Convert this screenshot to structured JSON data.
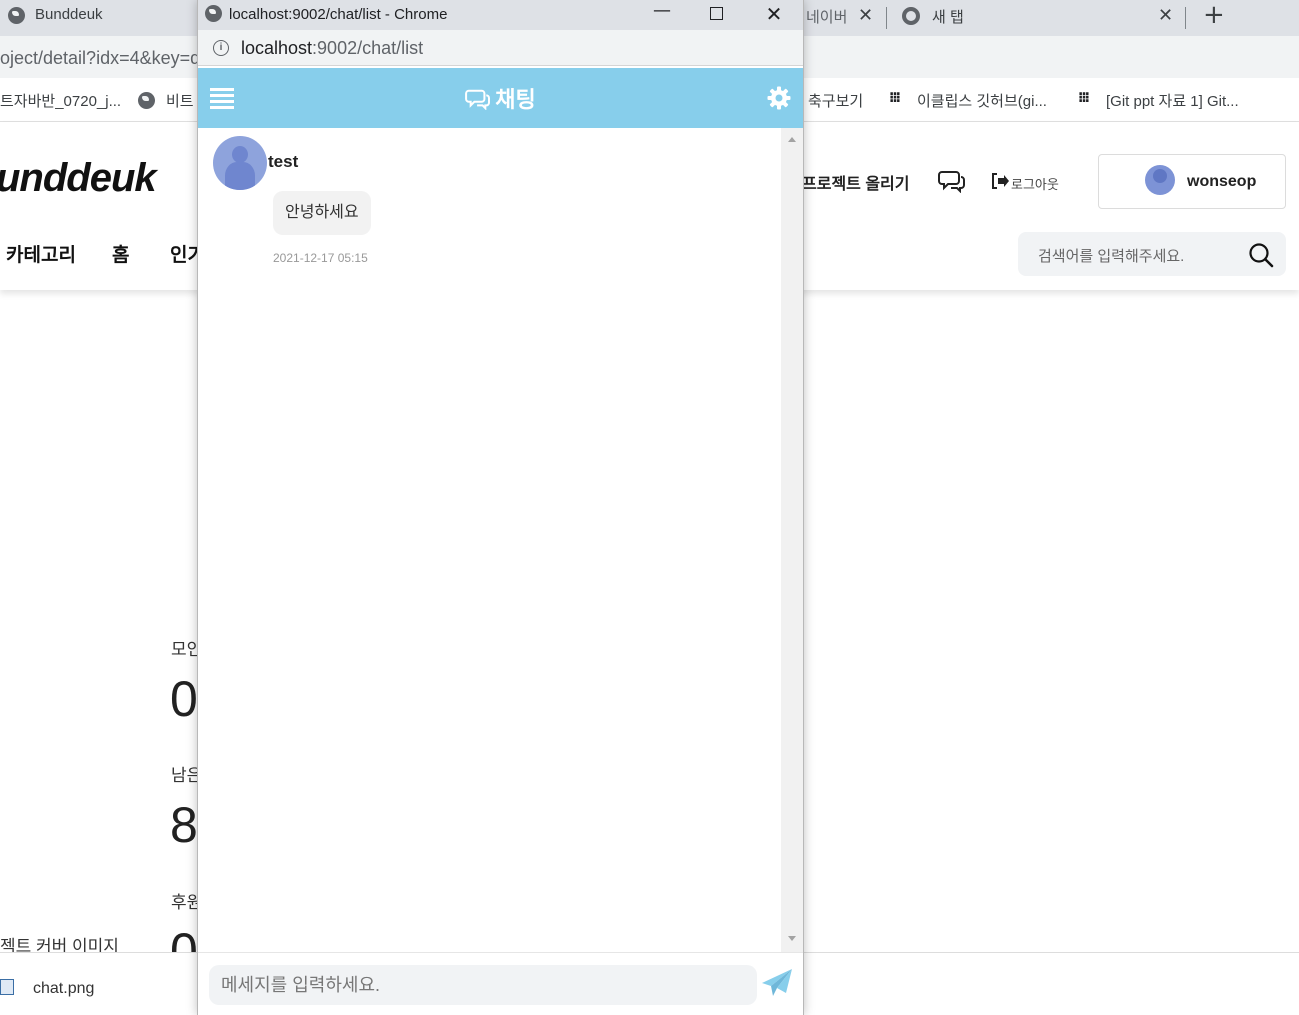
{
  "background_browser": {
    "tab_title": "Bunddeuk",
    "tab_partial": "네이버",
    "new_tab_label": "새 탭",
    "address_partial": "oject/detail?idx=4&key=d",
    "bookmarks": [
      "트자바반_0720_j...",
      "비트",
      "축구보기",
      "이클립스 깃허브(gi...",
      "[Git ppt 자료 1] Git..."
    ]
  },
  "site": {
    "logo": "unddeuk",
    "nav": [
      "카테고리",
      "홈",
      "인기"
    ],
    "upload_project": "프로젝트 올리기",
    "logout": "로그아웃",
    "username": "wonseop",
    "search_placeholder": "검색어를 입력해주세요."
  },
  "page_body": {
    "stats": [
      {
        "label": "모인",
        "value": "0"
      },
      {
        "label": "남은",
        "value": "8"
      },
      {
        "label": "후원",
        "value": "0"
      }
    ],
    "cover_label": "젝트 커버 이미지"
  },
  "download_bar": {
    "file_name": "chat.png"
  },
  "popup": {
    "window_title": "localhost:9002/chat/list - Chrome",
    "url_host": "localhost",
    "url_rest": ":9002/chat/list",
    "header_title": "채팅",
    "colors": {
      "header": "#87ceeb"
    },
    "messages": [
      {
        "user": "test",
        "text": "안녕하세요",
        "time": "2021-12-17 05:15"
      }
    ],
    "input_placeholder": "메세지를 입력하세요."
  }
}
